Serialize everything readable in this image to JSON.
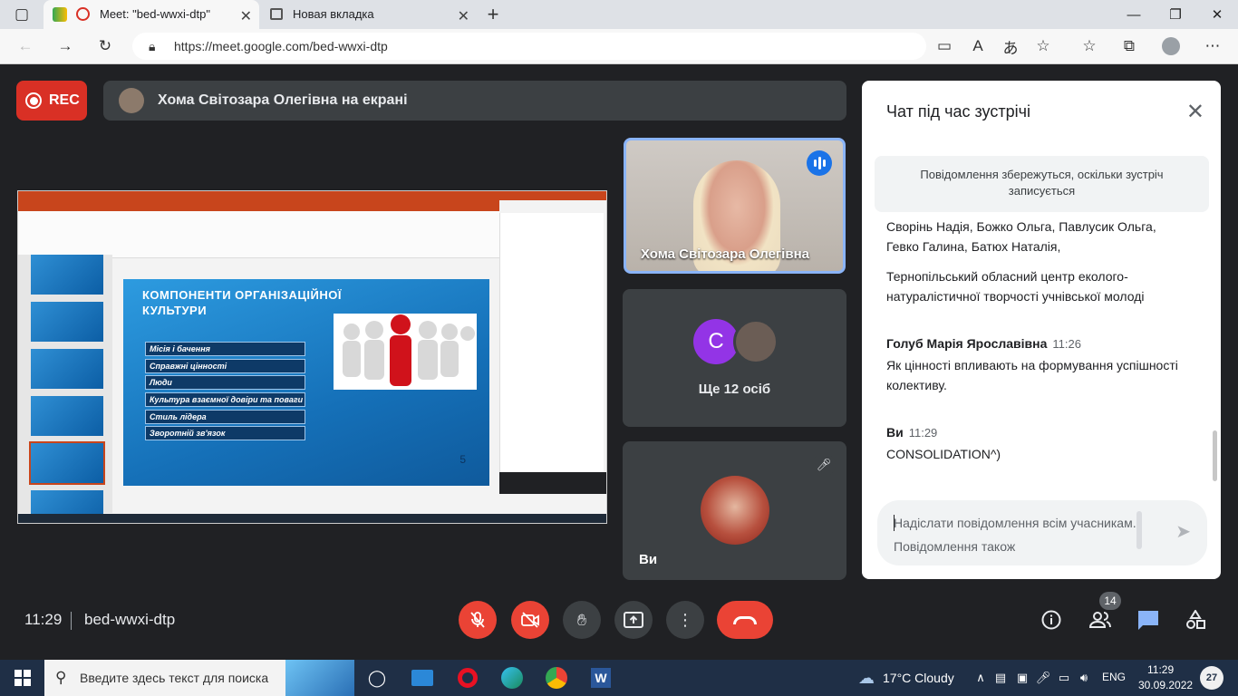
{
  "browser": {
    "tabs": [
      {
        "title": "Meet: \"bed-wwxi-dtp\""
      },
      {
        "title": "Новая вкладка"
      }
    ],
    "url": "https://meet.google.com/bed-wwxi-dtp"
  },
  "meet": {
    "rec_label": "REC",
    "presenting_banner": "Хома Світозара Олегівна на екрані",
    "shared_slide": {
      "title": "КОМПОНЕНТИ ОРГАНІЗАЦІЙНОЇ КУЛЬТУРИ",
      "items": [
        "Місія і бачення",
        "Справжні цінності",
        "Люди",
        "Культура взаємної довіри та поваги",
        "Стиль лідера",
        "Зворотній зв'язок"
      ],
      "page_number": "5"
    },
    "tiles": {
      "speaker_name": "Хома Світозара Олегівна",
      "more_avatar_letter": "C",
      "more_label": "Ще 12 осіб",
      "self_name": "Ви"
    }
  },
  "chat": {
    "title": "Чат під час зустрічі",
    "note": "Повідомлення збережуться, оскільки зустріч записується",
    "messages": [
      {
        "text": "Сворінь Надія, Божко Ольга, Павлусик Ольга, Гевко Галина, Батюх Наталія,"
      },
      {
        "text": "Тернопільський обласний центр еколого-натуралістичної творчості учнівської молоді"
      },
      {
        "sender": "Голуб Марія Ярославівна",
        "time": "11:26",
        "text": "Як цінності впливають на формування успішності  колективу."
      },
      {
        "sender": "Ви",
        "time": "11:29",
        "text": "CONSOLIDATION^)"
      }
    ],
    "input_placeholder": "Надіслати повідомлення всім учасникам. Повідомлення також"
  },
  "bottom": {
    "time": "11:29",
    "meeting_code": "bed-wwxi-dtp",
    "participants_count": "14"
  },
  "taskbar": {
    "search_placeholder": "Введите здесь текст для поиска",
    "weather": "17°C  Cloudy",
    "lang": "ENG",
    "time": "11:29",
    "date": "30.09.2022",
    "notifications": "27"
  }
}
